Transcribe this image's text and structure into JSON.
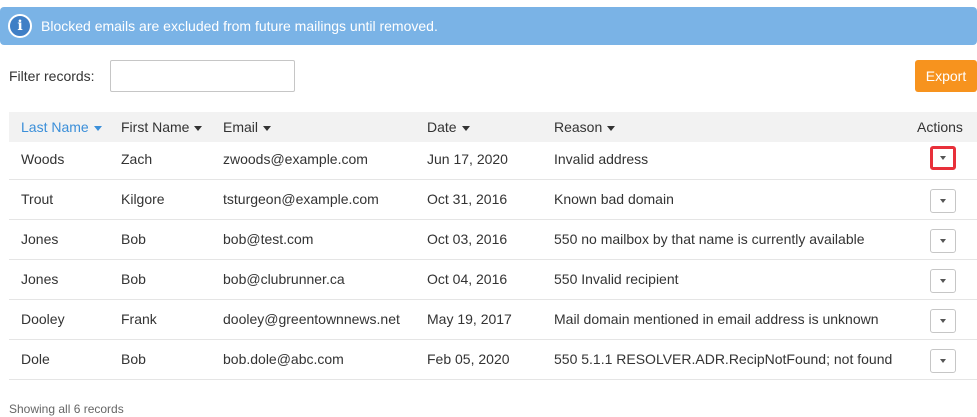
{
  "banner": {
    "icon": "info-icon",
    "icon_glyph": "i",
    "message": "Blocked emails are excluded from future mailings until removed."
  },
  "filter": {
    "label": "Filter records:",
    "value": "",
    "placeholder": ""
  },
  "export_button": {
    "label": "Export",
    "color": "#f7931e"
  },
  "table": {
    "columns": [
      {
        "key": "last_name",
        "label": "Last Name",
        "sorted": true
      },
      {
        "key": "first_name",
        "label": "First Name",
        "sorted": false
      },
      {
        "key": "email",
        "label": "Email",
        "sorted": false
      },
      {
        "key": "date",
        "label": "Date",
        "sorted": false
      },
      {
        "key": "reason",
        "label": "Reason",
        "sorted": false
      }
    ],
    "actions_label": "Actions",
    "rows": [
      {
        "last_name": "Woods",
        "first_name": "Zach",
        "email": "zwoods@example.com",
        "date": "Jun 17, 2020",
        "reason": "Invalid address",
        "highlighted": true
      },
      {
        "last_name": "Trout",
        "first_name": "Kilgore",
        "email": "tsturgeon@example.com",
        "date": "Oct 31, 2016",
        "reason": "Known bad domain",
        "highlighted": false
      },
      {
        "last_name": "Jones",
        "first_name": "Bob",
        "email": "bob@test.com",
        "date": "Oct 03, 2016",
        "reason": "550 no mailbox by that name is currently available",
        "highlighted": false
      },
      {
        "last_name": "Jones",
        "first_name": "Bob",
        "email": "bob@clubrunner.ca",
        "date": "Oct 04, 2016",
        "reason": "550 Invalid recipient",
        "highlighted": false
      },
      {
        "last_name": "Dooley",
        "first_name": "Frank",
        "email": "dooley@greentownnews.net",
        "date": "May 19, 2017",
        "reason": "Mail domain mentioned in email address is unknown",
        "highlighted": false
      },
      {
        "last_name": "Dole",
        "first_name": "Bob",
        "email": "bob.dole@abc.com",
        "date": "Feb 05, 2020",
        "reason": "550 5.1.1 RESOLVER.ADR.RecipNotFound; not found",
        "highlighted": false
      }
    ]
  },
  "footer": {
    "status": "Showing all 6 records"
  },
  "colors": {
    "banner": "#7ab3e6",
    "sorted_header": "#3b8fd9",
    "highlight_outline": "#e8303a"
  }
}
